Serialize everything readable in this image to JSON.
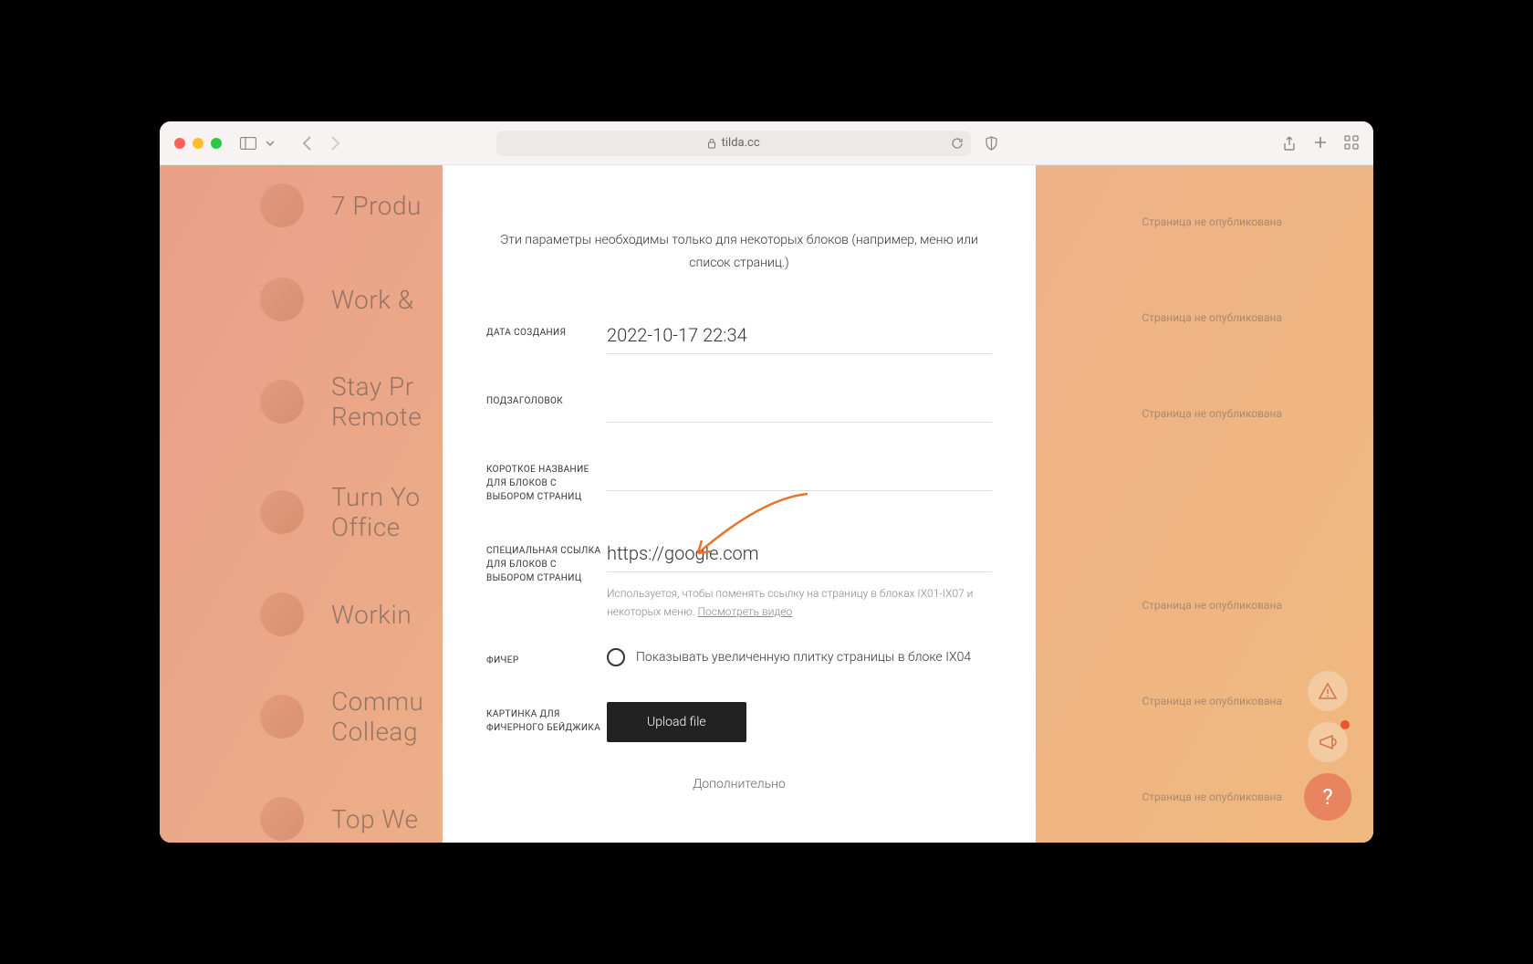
{
  "browser": {
    "url_host": "tilda.cc"
  },
  "background": {
    "items": [
      {
        "title": "7 Produ"
      },
      {
        "title": "Work &"
      },
      {
        "title": "Stay Pr\nRemote"
      },
      {
        "title": "Turn Yo\nOffice"
      },
      {
        "title": "Workin"
      },
      {
        "title": "Commu\nColleag"
      },
      {
        "title": "Top We"
      }
    ],
    "status_text": "Страница не опубликована"
  },
  "modal": {
    "description": "Эти параметры необходимы только для некоторых блоков (например, меню или список страниц.)",
    "fields": {
      "created_label": "ДАТА СОЗДАНИЯ",
      "created_value": "2022-10-17 22:34",
      "subtitle_label": "ПОДЗАГОЛОВОК",
      "subtitle_value": "",
      "shortname_label": "КОРОТКОЕ НАЗВАНИЕ ДЛЯ БЛОКОВ С ВЫБОРОМ СТРАНИЦ",
      "shortname_value": "",
      "speclink_label": "СПЕЦИАЛЬНАЯ ССЫЛКА ДЛЯ БЛОКОВ С ВЫБОРОМ СТРАНИЦ",
      "speclink_value": "https://google.com",
      "speclink_hint_pre": "Используется, чтобы поменять ссылку на страницу в блоках IX01-IX07 и некоторых меню. ",
      "speclink_hint_link": "Посмотреть видео",
      "feature_label": "ФИЧЕР",
      "feature_option": "Показывать увеличенную плитку страницы в блоке IX04",
      "badge_label": "КАРТИНКА ДЛЯ ФИЧЕРНОГО БЕЙДЖИКА",
      "upload_button": "Upload file",
      "more": "Дополнительно"
    }
  },
  "fab": {
    "help": "?"
  }
}
